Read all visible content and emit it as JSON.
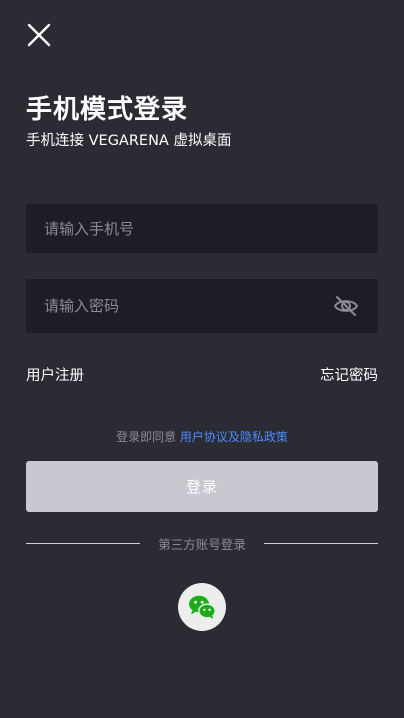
{
  "header": {
    "close_icon": "close-icon",
    "title": "手机模式登录",
    "subtitle": "手机连接 VEGARENA 虚拟桌面"
  },
  "form": {
    "phone_placeholder": "请输入手机号",
    "phone_value": "",
    "password_placeholder": "请输入密码",
    "password_value": "",
    "visibility_icon": "eye-off-icon"
  },
  "links": {
    "register": "用户注册",
    "forgot_password": "忘记密码"
  },
  "agreement": {
    "prefix": "登录即同意",
    "policy": "用户协议及隐私政策"
  },
  "login_button": "登录",
  "third_party": {
    "label": "第三方账号登录",
    "wechat_icon": "wechat-icon"
  },
  "colors": {
    "background": "#2b2b34",
    "field_bg": "#1d1d26",
    "accent_link": "#4f8cff",
    "button_disabled": "#c7c8d0",
    "wechat_green": "#1aad19"
  }
}
